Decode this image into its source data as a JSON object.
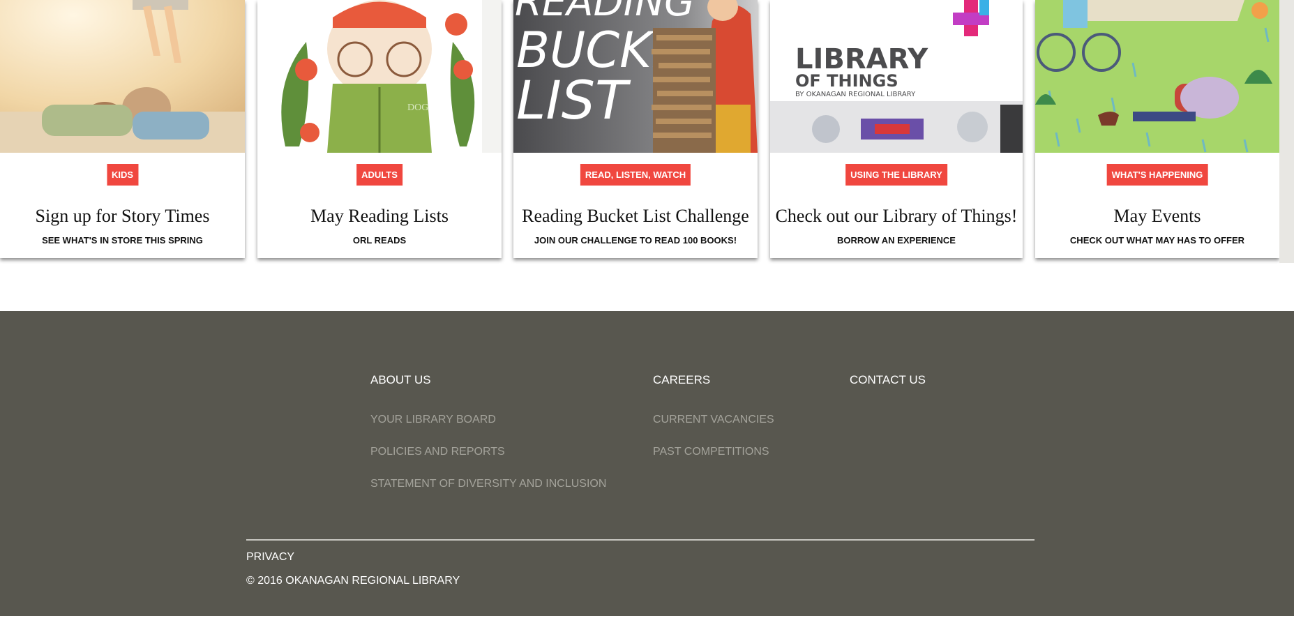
{
  "cards": [
    {
      "badge": "KIDS",
      "title": "Sign up for Story Times",
      "subtitle": "SEE WHAT'S IN STORE THIS SPRING"
    },
    {
      "badge": "ADULTS",
      "title": "May Reading Lists",
      "subtitle": "ORL READS",
      "image_text": "DOG"
    },
    {
      "badge": "READ, LISTEN, WATCH",
      "title": "Reading Bucket List Challenge",
      "subtitle": "JOIN OUR CHALLENGE TO READ 100 BOOKS!",
      "image_text": [
        "READING",
        "BUCKET",
        "LIST"
      ]
    },
    {
      "badge": "USING THE LIBRARY",
      "title": "Check out our Library of Things!",
      "subtitle": "BORROW AN EXPERIENCE",
      "image_text": [
        "LIBRARY",
        "OF THINGS",
        "BY OKANAGAN REGIONAL LIBRARY"
      ]
    },
    {
      "badge": "WHAT'S HAPPENING",
      "title": "May Events",
      "subtitle": "CHECK OUT WHAT MAY HAS TO OFFER"
    }
  ],
  "footer": {
    "columns": [
      {
        "heading": "ABOUT US",
        "links": [
          "YOUR LIBRARY BOARD",
          "POLICIES AND REPORTS",
          "STATEMENT OF DIVERSITY AND INCLUSION"
        ]
      },
      {
        "heading": "CAREERS",
        "links": [
          "CURRENT VACANCIES",
          "PAST COMPETITIONS"
        ]
      },
      {
        "heading": "CONTACT US",
        "links": []
      }
    ],
    "privacy": "PRIVACY",
    "copyright": "© 2016 OKANAGAN REGIONAL LIBRARY"
  },
  "colors": {
    "badge": "#f0473f",
    "footer_bg": "#58574f",
    "footer_link": "#a4a39b"
  }
}
